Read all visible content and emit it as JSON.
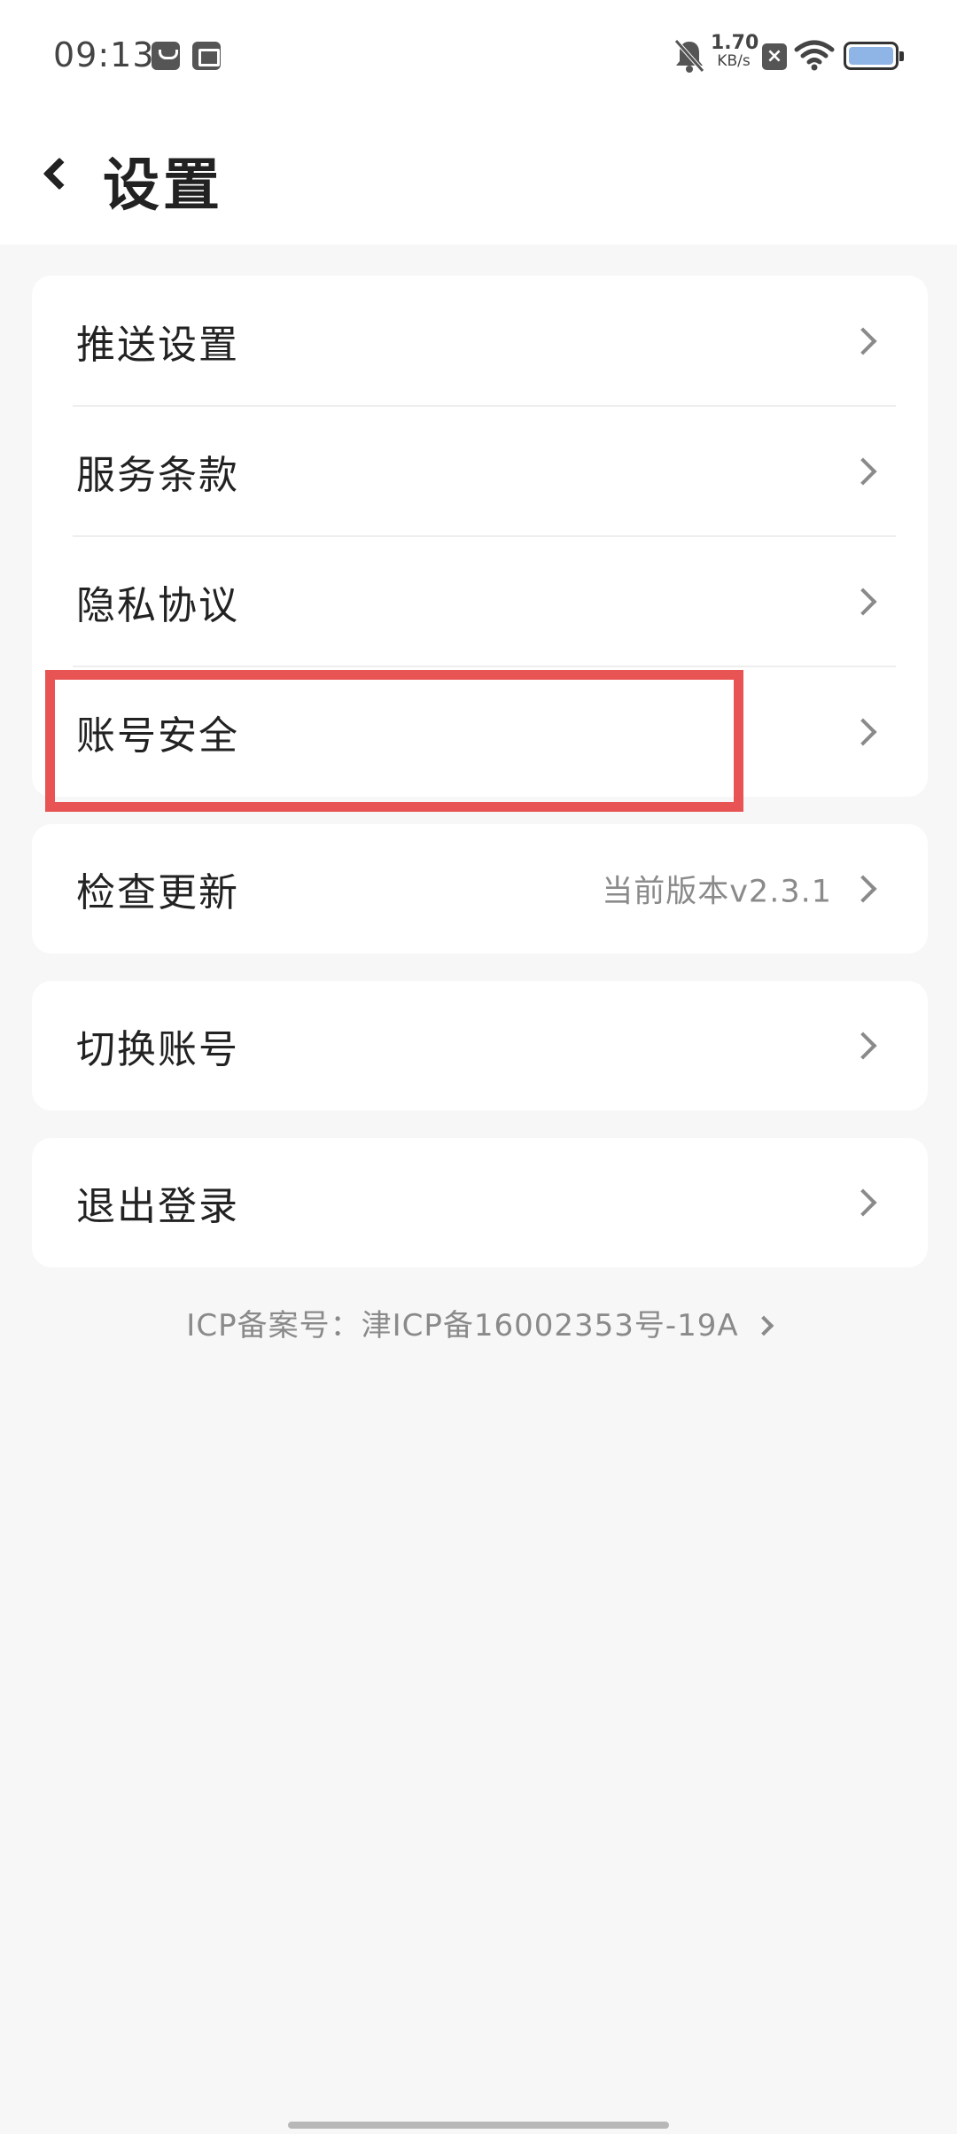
{
  "status_bar": {
    "time": "09:13",
    "net_speed_value": "1.70",
    "net_speed_unit": "KB/s",
    "icons": [
      "notification-icon",
      "notification-icon",
      "bell-muted-icon",
      "sim-off-icon",
      "wifi-icon",
      "battery-icon"
    ],
    "battery_color": "#8fb4e6"
  },
  "header": {
    "title": "设置",
    "back_icon": "chevron-left-icon"
  },
  "settings": {
    "group1": [
      {
        "label": "推送设置"
      },
      {
        "label": "服务条款"
      },
      {
        "label": "隐私协议"
      },
      {
        "label": "账号安全"
      }
    ],
    "check_update": {
      "label": "检查更新",
      "version": "当前版本v2.3.1"
    },
    "switch_account": {
      "label": "切换账号"
    },
    "logout": {
      "label": "退出登录"
    }
  },
  "footer": {
    "icp": "ICP备案号：津ICP备16002353号-19A"
  },
  "colors": {
    "highlight": "#e85454",
    "background": "#f7f7f7",
    "card": "#ffffff",
    "secondary_text": "#8a8a8a"
  }
}
